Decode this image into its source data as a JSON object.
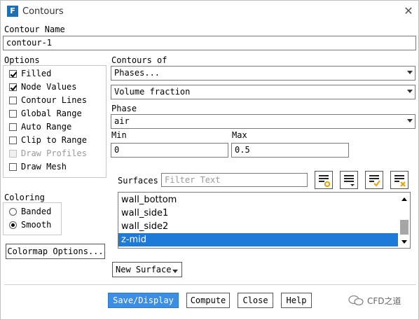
{
  "window": {
    "title": "Contours",
    "app_icon": "F"
  },
  "contour_name": {
    "label": "Contour Name",
    "value": "contour-1"
  },
  "options": {
    "label": "Options",
    "items": [
      {
        "label": "Filled",
        "checked": true,
        "enabled": true
      },
      {
        "label": "Node Values",
        "checked": true,
        "enabled": true
      },
      {
        "label": "Contour Lines",
        "checked": false,
        "enabled": true
      },
      {
        "label": "Global Range",
        "checked": false,
        "enabled": true
      },
      {
        "label": "Auto Range",
        "checked": false,
        "enabled": true
      },
      {
        "label": "Clip to Range",
        "checked": false,
        "enabled": true
      },
      {
        "label": "Draw Profiles",
        "checked": false,
        "enabled": false
      },
      {
        "label": "Draw Mesh",
        "checked": false,
        "enabled": true
      }
    ]
  },
  "contours_of": {
    "label": "Contours of",
    "primary": "Phases...",
    "secondary": "Volume fraction"
  },
  "phase": {
    "label": "Phase",
    "value": "air"
  },
  "range": {
    "min_label": "Min",
    "min_value": "0",
    "max_label": "Max",
    "max_value": "0.5"
  },
  "surfaces": {
    "label": "Surfaces",
    "filter_placeholder": "Filter Text",
    "items": [
      {
        "label": "wall_bottom",
        "selected": false
      },
      {
        "label": "wall_side1",
        "selected": false
      },
      {
        "label": "wall_side2",
        "selected": false
      },
      {
        "label": "z-mid",
        "selected": true
      }
    ],
    "new_surface_label": "New Surface"
  },
  "coloring": {
    "label": "Coloring",
    "options": [
      {
        "label": "Banded",
        "selected": false
      },
      {
        "label": "Smooth",
        "selected": true
      }
    ]
  },
  "colormap_button": "Colormap Options...",
  "footer": {
    "save_display": "Save/Display",
    "compute": "Compute",
    "close": "Close",
    "help": "Help"
  },
  "watermark": "CFD之道",
  "colors": {
    "primary_button": "#3a8ee6",
    "selection": "#1e7ad8",
    "accent_icon": "#e8a200"
  }
}
